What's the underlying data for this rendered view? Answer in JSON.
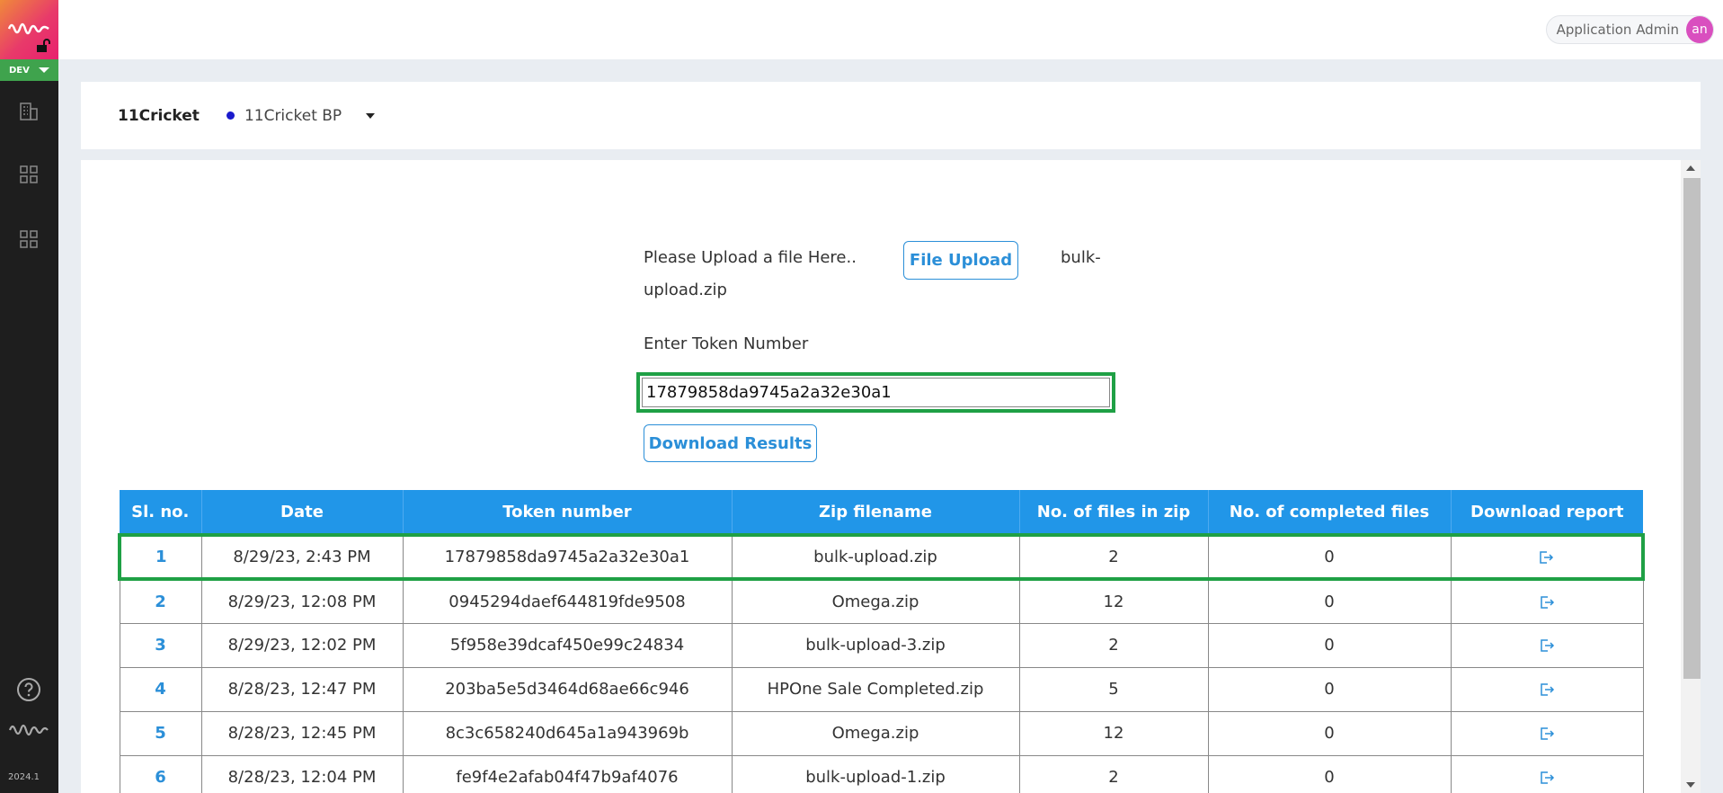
{
  "sidebar": {
    "env_label": "DEV",
    "version": "2024.1"
  },
  "topbar": {
    "user_name": "Application Admin",
    "avatar_initials": "an"
  },
  "org": {
    "name": "11Cricket",
    "business_partner": "11Cricket BP"
  },
  "upload": {
    "label": "Please Upload a file Here..",
    "button_label": "File Upload",
    "filename_part1": "bulk-",
    "filename_part2": "upload.zip"
  },
  "token": {
    "label": "Enter Token Number",
    "value": "17879858da9745a2a32e30a1",
    "download_button": "Download Results"
  },
  "table": {
    "headers": {
      "sl": "Sl. no.",
      "date": "Date",
      "token": "Token number",
      "zip": "Zip filename",
      "files": "No. of files in zip",
      "completed": "No. of completed files",
      "report": "Download report"
    },
    "rows": [
      {
        "sl": "1",
        "date": "8/29/23, 2:43 PM",
        "token": "17879858da9745a2a32e30a1",
        "zip": "bulk-upload.zip",
        "files": "2",
        "completed": "0"
      },
      {
        "sl": "2",
        "date": "8/29/23, 12:08 PM",
        "token": "0945294daef644819fde9508",
        "zip": "Omega.zip",
        "files": "12",
        "completed": "0"
      },
      {
        "sl": "3",
        "date": "8/29/23, 12:02 PM",
        "token": "5f958e39dcaf450e99c24834",
        "zip": "bulk-upload-3.zip",
        "files": "2",
        "completed": "0"
      },
      {
        "sl": "4",
        "date": "8/28/23, 12:47 PM",
        "token": "203ba5e5d3464d68ae66c946",
        "zip": "HPOne Sale Completed.zip",
        "files": "5",
        "completed": "0"
      },
      {
        "sl": "5",
        "date": "8/28/23, 12:45 PM",
        "token": "8c3c658240d645a1a943969b",
        "zip": "Omega.zip",
        "files": "12",
        "completed": "0"
      },
      {
        "sl": "6",
        "date": "8/28/23, 12:04 PM",
        "token": "fe9f4e2afab04f47b9af4076",
        "zip": "bulk-upload-1.zip",
        "files": "2",
        "completed": "0"
      }
    ]
  },
  "colors": {
    "accent": "#2196e8",
    "highlight": "#1fa045",
    "env_badge": "#3fa34d",
    "sidebar": "#1e1e1e"
  }
}
